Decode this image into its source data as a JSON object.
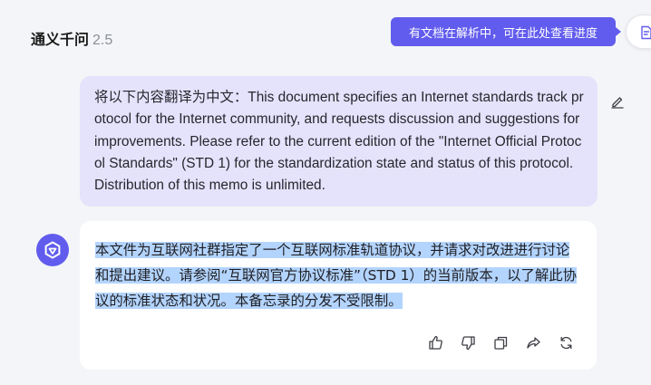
{
  "header": {
    "app_name": "通义千问",
    "version": "2.5"
  },
  "tooltip": {
    "text": "有文档在解析中，可在此处查看进度"
  },
  "icons": {
    "document": "document-progress-icon",
    "edit": "edit-icon",
    "avatar": "qwen-logo-icon",
    "like": "thumbs-up-icon",
    "dislike": "thumbs-down-icon",
    "copy": "copy-icon",
    "share": "share-icon",
    "regenerate": "regenerate-icon"
  },
  "conversation": {
    "user_message": "将以下内容翻译为中文：This document specifies an Internet standards track protocol for the Internet community, and requests discussion and suggestions for improvements. Please refer to the current edition of the \"Internet Official Protocol Standards\" (STD 1) for the standardization state and status of this protocol. Distribution of this memo is unlimited.",
    "assistant_message": "本文件为互联网社群指定了一个互联网标准轨道协议，并请求对改进进行讨论和提出建议。请参阅“互联网官方协议标准”（STD 1）的当前版本，以了解此协议的标准状态和状况。本备忘录的分发不受限制。"
  },
  "colors": {
    "accent": "#615ced",
    "user_bubble": "#e5e3fb",
    "selection": "#b3d4fd",
    "background": "#f4f5f8"
  }
}
